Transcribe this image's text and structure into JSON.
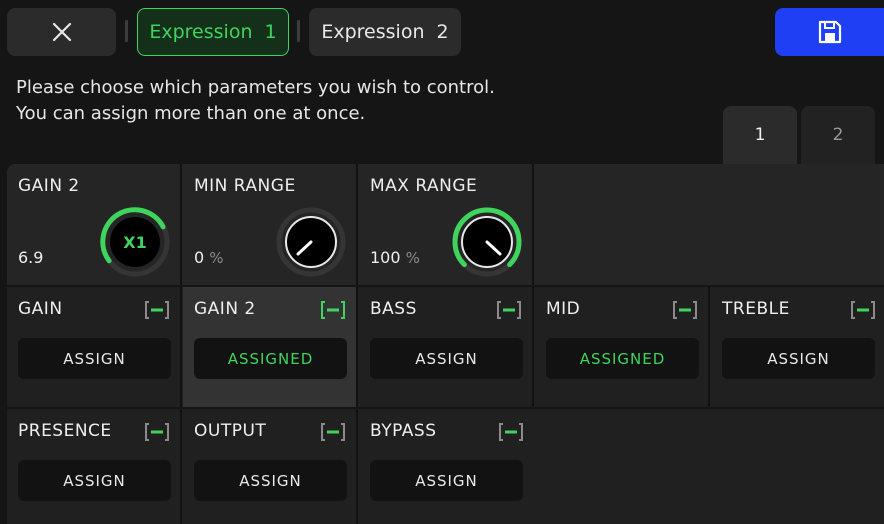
{
  "header": {
    "close_icon": "close-icon",
    "tabs": [
      {
        "label": "Expression  1",
        "active": true
      },
      {
        "label": "Expression  2",
        "active": false
      }
    ],
    "save_icon": "save-icon"
  },
  "instructions": {
    "line1": "Please choose which parameters you wish to control.",
    "line2": "You can assign more than one at once."
  },
  "pages": [
    "1",
    "2"
  ],
  "knobs": [
    {
      "title": "GAIN 2",
      "value": "6.9",
      "unit": "",
      "badge": "X1",
      "level": 0.69
    },
    {
      "title": "MIN RANGE",
      "value": "0",
      "unit": "%",
      "level": 0.0
    },
    {
      "title": "MAX RANGE",
      "value": "100",
      "unit": "%",
      "level": 1.0
    }
  ],
  "params_row1": [
    {
      "title": "GAIN",
      "button": "ASSIGN",
      "assigned": false
    },
    {
      "title": "GAIN 2",
      "button": "ASSIGNED",
      "assigned": true
    },
    {
      "title": "BASS",
      "button": "ASSIGN",
      "assigned": false
    },
    {
      "title": "MID",
      "button": "ASSIGNED",
      "assigned": true
    },
    {
      "title": "TREBLE",
      "button": "ASSIGN",
      "assigned": false
    }
  ],
  "params_row2": [
    {
      "title": "PRESENCE",
      "button": "ASSIGN",
      "assigned": false
    },
    {
      "title": "OUTPUT",
      "button": "ASSIGN",
      "assigned": false
    },
    {
      "title": "BYPASS",
      "button": "ASSIGN",
      "assigned": false
    }
  ],
  "colors": {
    "accent_green": "#3fd45c",
    "save_blue": "#1f3ff5"
  }
}
